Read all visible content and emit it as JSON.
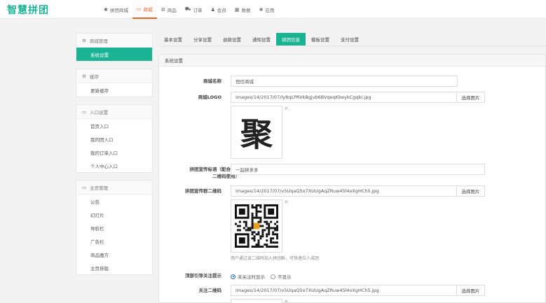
{
  "logo": "智慧拼团",
  "topnav": [
    {
      "icon": "✱",
      "icon_name": "puzzle-icon",
      "label": "拼团商城",
      "active": false
    },
    {
      "icon": "▭",
      "icon_name": "monitor-icon",
      "label": "商城",
      "active": true
    },
    {
      "icon": "⚙",
      "icon_name": "gift-icon",
      "label": "商品",
      "active": false
    },
    {
      "icon": "⛟",
      "icon_name": "cart-icon",
      "label": "订单",
      "active": false
    },
    {
      "icon": "♟",
      "icon_name": "user-icon",
      "label": "会员",
      "active": false
    },
    {
      "icon": "▦",
      "icon_name": "chart-icon",
      "label": "数据",
      "active": false
    },
    {
      "icon": "❀",
      "icon_name": "apps-icon",
      "label": "应用",
      "active": false
    }
  ],
  "sidebar": [
    {
      "title": "商城管理",
      "icon": "⚙",
      "icon_name": "gear-icon",
      "items": [
        {
          "label": "系统设置",
          "active": true
        }
      ]
    },
    {
      "title": "缓存",
      "icon": "⚙",
      "icon_name": "gear-icon",
      "items": [
        {
          "label": "更新缓存",
          "active": false
        }
      ]
    },
    {
      "title": "入口设置",
      "icon": "▭",
      "icon_name": "monitor-icon",
      "items": [
        {
          "label": "首页入口",
          "active": false
        },
        {
          "label": "我的团入口",
          "active": false
        },
        {
          "label": "我的订单入口",
          "active": false
        },
        {
          "label": "个人中心入口",
          "active": false
        }
      ]
    },
    {
      "title": "主页管理",
      "icon": "▭",
      "icon_name": "monitor-icon",
      "items": [
        {
          "label": "公告",
          "active": false
        },
        {
          "label": "幻灯片",
          "active": false
        },
        {
          "label": "导航栏",
          "active": false
        },
        {
          "label": "广告栏",
          "active": false
        },
        {
          "label": "商品魔方",
          "active": false
        },
        {
          "label": "主页排版",
          "active": false
        }
      ]
    }
  ],
  "tabs": [
    {
      "label": "基本设置",
      "active": false
    },
    {
      "label": "分享设置",
      "active": false
    },
    {
      "label": "退款设置",
      "active": false
    },
    {
      "label": "通知设置",
      "active": false
    },
    {
      "label": "拼团信息",
      "active": true
    },
    {
      "label": "模板设置",
      "active": false
    },
    {
      "label": "支付设置",
      "active": false
    }
  ],
  "panel": {
    "title": "系统设置",
    "shop_name_label": "商城名称",
    "shop_name_value": "恒信商城",
    "logo_label": "商城LOGO",
    "logo_path": "images/14/2017/07/ly8qLPRVkBgjvb6BVqeqKbeykCgqbi.jpg",
    "logo_glyph": "聚",
    "slogan_label_1": "拼团宣传标语（配合下方",
    "slogan_label_2": "二维码使用）",
    "slogan_value": "一起拼多多",
    "qr_label": "拼团宣传群二维码",
    "qr_path": "images/14/2017/07/v5UqaQ5o7XUUgAqZRuw45l4xXgHCh5.jpg",
    "qr_hint": "用户通过该二维码加入拼团群，可快速拉人成团",
    "follow_label": "顶部引导关注提示",
    "follow_options": [
      {
        "label": "未关注时显示",
        "checked": true
      },
      {
        "label": "不显示",
        "checked": false
      }
    ],
    "follow_qr_label": "关注二维码",
    "follow_qr_path": "images/14/2017/07/v5UqaQ5o7XUUgAqZRuw45l4xXgHCh5.jpg",
    "pick_button": "选择图片",
    "close_glyph": "×"
  },
  "colors": {
    "accent": "#1ab394",
    "active_nav": "#e8661f"
  }
}
